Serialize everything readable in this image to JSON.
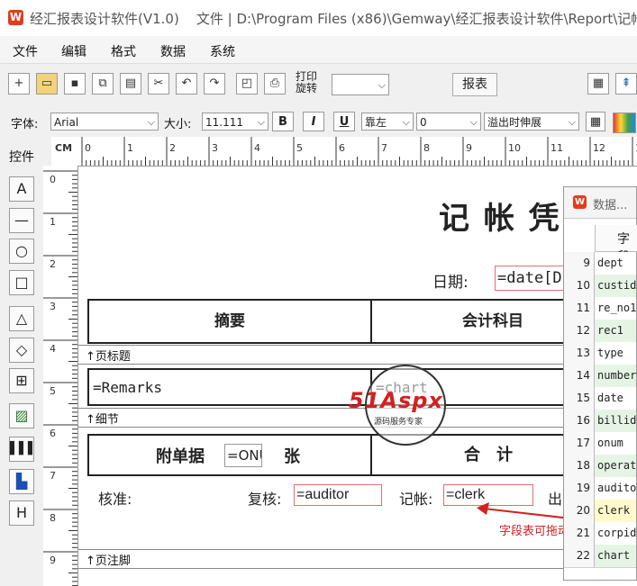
{
  "window": {
    "title": "经汇报表设计软件(V1.0)",
    "file_path": "文件 | D:\\Program Files (x86)\\Gemway\\经汇报表设计软件\\Report\\记帐"
  },
  "menu": [
    "文件",
    "编辑",
    "格式",
    "数据",
    "系统"
  ],
  "toolbar": {
    "print_rotate_line1": "打印",
    "print_rotate_line2": "旋转",
    "report_button": "报表"
  },
  "fontbar": {
    "font_label": "字体:",
    "font_value": "Arial",
    "size_label": "大小:",
    "size_value": "11.111",
    "bold": "B",
    "italic": "I",
    "underline": "U",
    "align_value": "靠左",
    "indent_value": "0",
    "overflow_value": "溢出时伸展"
  },
  "palette": {
    "label": "控件",
    "text_tool": "A",
    "h_tool": "H"
  },
  "ruler": {
    "unit": "CM",
    "h_ticks": [
      "0",
      "1",
      "2",
      "3",
      "4",
      "5",
      "6",
      "7",
      "8",
      "9",
      "10",
      "11",
      "12",
      "1"
    ],
    "v_ticks": [
      "0",
      "1",
      "2",
      "3",
      "4",
      "5",
      "6",
      "7",
      "8",
      "9"
    ]
  },
  "report": {
    "title": "记 帐 凭",
    "date_label": "日期:",
    "date_field": "=date[D",
    "col_summary": "摘要",
    "col_account": "会计科目",
    "band_page_header": "↑页标题",
    "remarks_field": "=Remarks",
    "chart_field": "=chart",
    "band_detail": "↑细节",
    "attach_label": "附单据",
    "attach_field": "=ONU",
    "attach_unit": "张",
    "total_label": "合　计",
    "approve_label": "核准:",
    "review_label": "复核:",
    "review_field": "=auditor",
    "bookkeep_label": "记帐:",
    "bookkeep_field": "=clerk",
    "cashier_label": "出",
    "band_page_footer": "↑页注脚",
    "drag_hint": "字段表可拖动"
  },
  "watermark": {
    "brand": "51Aspx",
    "tagline": "源码服务专家"
  },
  "data_panel": {
    "title": "数据...",
    "header": "字段",
    "rows": [
      {
        "n": "9",
        "f": "dept"
      },
      {
        "n": "10",
        "f": "custid"
      },
      {
        "n": "11",
        "f": "re_no1"
      },
      {
        "n": "12",
        "f": "rec1"
      },
      {
        "n": "13",
        "f": "type"
      },
      {
        "n": "14",
        "f": "number"
      },
      {
        "n": "15",
        "f": "date"
      },
      {
        "n": "16",
        "f": "billid"
      },
      {
        "n": "17",
        "f": "onum"
      },
      {
        "n": "18",
        "f": "operat"
      },
      {
        "n": "19",
        "f": "audito"
      },
      {
        "n": "20",
        "f": "clerk"
      },
      {
        "n": "21",
        "f": "corpid"
      },
      {
        "n": "22",
        "f": "chart"
      }
    ]
  },
  "colors": {
    "logo_red": "#e23c1d",
    "field_border": "#e07070",
    "row_green": "#e6f4e6",
    "row_selected": "#fff9cc",
    "hint_red": "#d42020"
  }
}
